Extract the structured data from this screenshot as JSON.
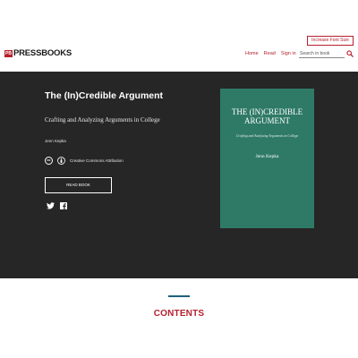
{
  "header": {
    "font_size_button": "Increase Font Size",
    "logo": {
      "mark": "PB",
      "text": "PRESSBOOKS"
    },
    "nav": [
      "Home",
      "Read",
      "Sign in"
    ],
    "search": {
      "placeholder": "Search in book"
    }
  },
  "hero": {
    "title": "The (In)Credible Argument",
    "subtitle": "Crafting and Analyzing Arguments in College",
    "author": "Jenn Kepka",
    "license": {
      "cc_mark": "cc",
      "label": "Creative Commons Attribution"
    },
    "read_button": "READ BOOK",
    "social": [
      "twitter-icon",
      "facebook-icon"
    ]
  },
  "cover": {
    "title_line1": "THE (IN)CREDIBLE",
    "title_line2": "ARGUMENT",
    "subtitle": "Crafting and Analyzing Arguments in College",
    "author": "Jenn Kepka"
  },
  "contents": {
    "heading": "CONTENTS"
  },
  "colors": {
    "accent": "#b5202e",
    "hero_bg": "#262626",
    "cover_bg": "#2f7a67",
    "rule": "#1f5f7a"
  }
}
